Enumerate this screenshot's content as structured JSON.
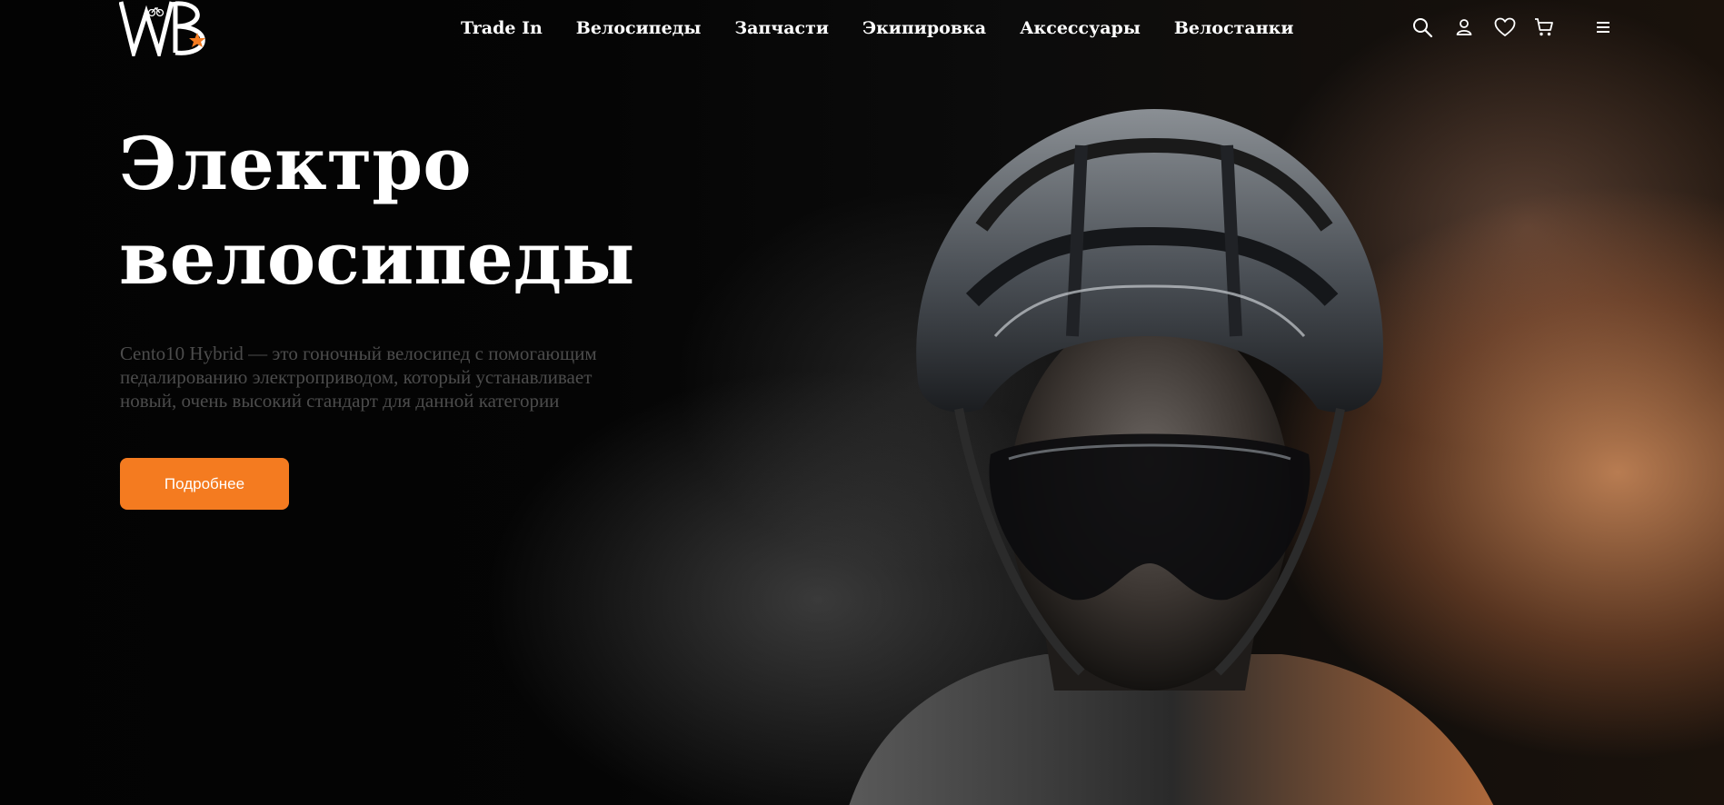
{
  "brand": {
    "logo_text": "WB",
    "accent_color": "#f47b20"
  },
  "nav": {
    "items": [
      {
        "label": "Trade In"
      },
      {
        "label": "Велосипеды"
      },
      {
        "label": "Запчасти"
      },
      {
        "label": "Экипировка"
      },
      {
        "label": "Аксессуары"
      },
      {
        "label": "Велостанки"
      }
    ]
  },
  "header_icons": [
    "search-icon",
    "user-icon",
    "heart-icon",
    "cart-icon",
    "menu-icon"
  ],
  "hero": {
    "title_line1": "Электро",
    "title_line2": "велосипеды",
    "description_line1": "Cento10 Hybrid — это гоночный велосипед с помогающим",
    "description_line2": "педалированию электроприводом, который устанавливает",
    "description_line3": "новый, очень высокий стандарт для данной категории",
    "button_label": "Подробнее"
  }
}
